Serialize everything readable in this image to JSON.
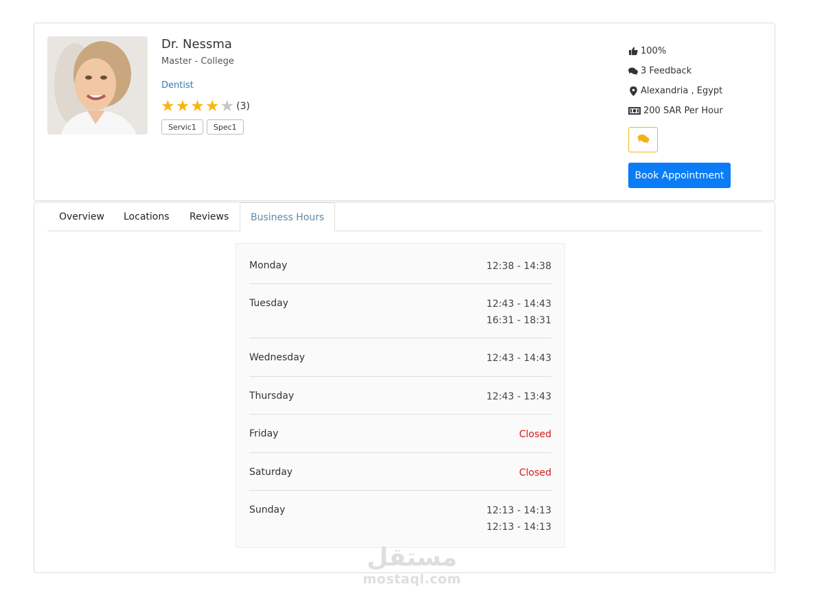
{
  "profile": {
    "name": "Dr. Nessma",
    "degree": "Master - College",
    "specialty": "Dentist",
    "rating": 4,
    "rating_max": 5,
    "rating_count": "(3)",
    "tags": [
      "Servic1",
      "Spec1"
    ]
  },
  "meta": {
    "likes": "100%",
    "feedback": "3 Feedback",
    "location": "Alexandria , Egypt",
    "price": "200 SAR Per Hour"
  },
  "actions": {
    "book_label": "Book Appointment"
  },
  "tabs": [
    {
      "label": "Overview",
      "active": false
    },
    {
      "label": "Locations",
      "active": false
    },
    {
      "label": "Reviews",
      "active": false
    },
    {
      "label": "Business Hours",
      "active": true
    }
  ],
  "business_hours": [
    {
      "day": "Monday",
      "slots": [
        "12:38 - 14:38"
      ],
      "closed": false
    },
    {
      "day": "Tuesday",
      "slots": [
        "12:43 - 14:43",
        "16:31 - 18:31"
      ],
      "closed": false
    },
    {
      "day": "Wednesday",
      "slots": [
        "12:43 - 14:43"
      ],
      "closed": false
    },
    {
      "day": "Thursday",
      "slots": [
        "12:43 - 13:43"
      ],
      "closed": false
    },
    {
      "day": "Friday",
      "slots": [
        "Closed"
      ],
      "closed": true
    },
    {
      "day": "Saturday",
      "slots": [
        "Closed"
      ],
      "closed": true
    },
    {
      "day": "Sunday",
      "slots": [
        "12:13 - 14:13",
        "12:13 - 14:13"
      ],
      "closed": false
    }
  ],
  "watermark": {
    "arabic": "مستقل",
    "latin": "mostaql.com"
  },
  "colors": {
    "primary": "#0a7cf5",
    "star": "#f8b50c",
    "closed": "#d01a1a",
    "link": "#2a7fb8",
    "chat_border": "#f0b51c"
  }
}
